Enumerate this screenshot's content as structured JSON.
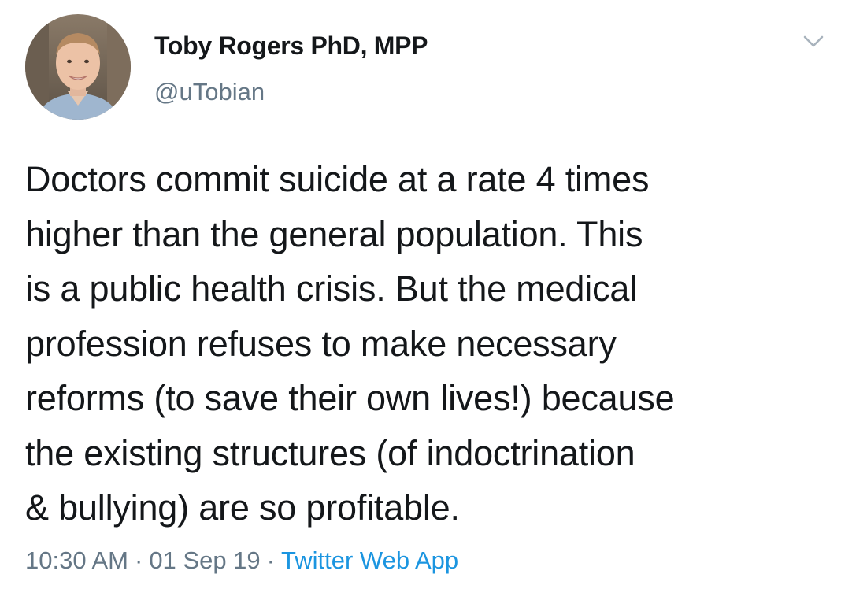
{
  "tweet": {
    "author": {
      "display_name": "Toby Rogers PhD, MPP",
      "handle": "@uTobian",
      "avatar_icon": "profile-photo"
    },
    "menu_icon": "chevron-down-icon",
    "text": "Doctors commit suicide at a rate 4 times\nhigher than the general population. This\nis a public health crisis. But the medical\nprofession refuses to make necessary\nreforms (to save their own lives!) because\nthe existing structures (of indoctrination\n& bullying) are so profitable.",
    "meta": {
      "time": "10:30 AM",
      "date": "01 Sep 19",
      "separator": "·",
      "source": "Twitter Web App"
    }
  },
  "colors": {
    "text_primary": "#14171a",
    "text_secondary": "#657786",
    "link": "#1b95e0",
    "background": "#ffffff"
  }
}
